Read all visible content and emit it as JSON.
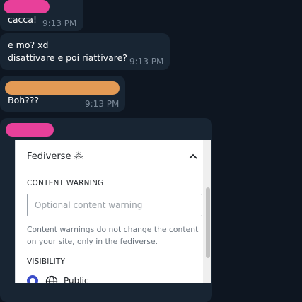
{
  "colors": {
    "background": "#0e1621",
    "bubble": "#182533",
    "name_pink": "#e8409a",
    "name_orange": "#e39a55",
    "accent": "#3a4cc9"
  },
  "messages": [
    {
      "text": "cacca!",
      "time": "9:13 PM"
    },
    {
      "text": "e mo? xd\ndisattivare e poi riattivare?",
      "time": "9:13 PM"
    },
    {
      "text": "Boh???",
      "time": "9:13 PM"
    }
  ],
  "panel": {
    "title": "Fediverse ⁂",
    "content_warning_label": "CONTENT WARNING",
    "content_warning_placeholder": "Optional content warning",
    "content_warning_value": "",
    "help_text": "Content warnings do not change the content on your site, only in the fediverse.",
    "visibility_label": "VISIBILITY",
    "visibility_option": "Public"
  },
  "icons": {
    "collapse": "chevron-up-icon",
    "visibility": "globe-icon"
  }
}
